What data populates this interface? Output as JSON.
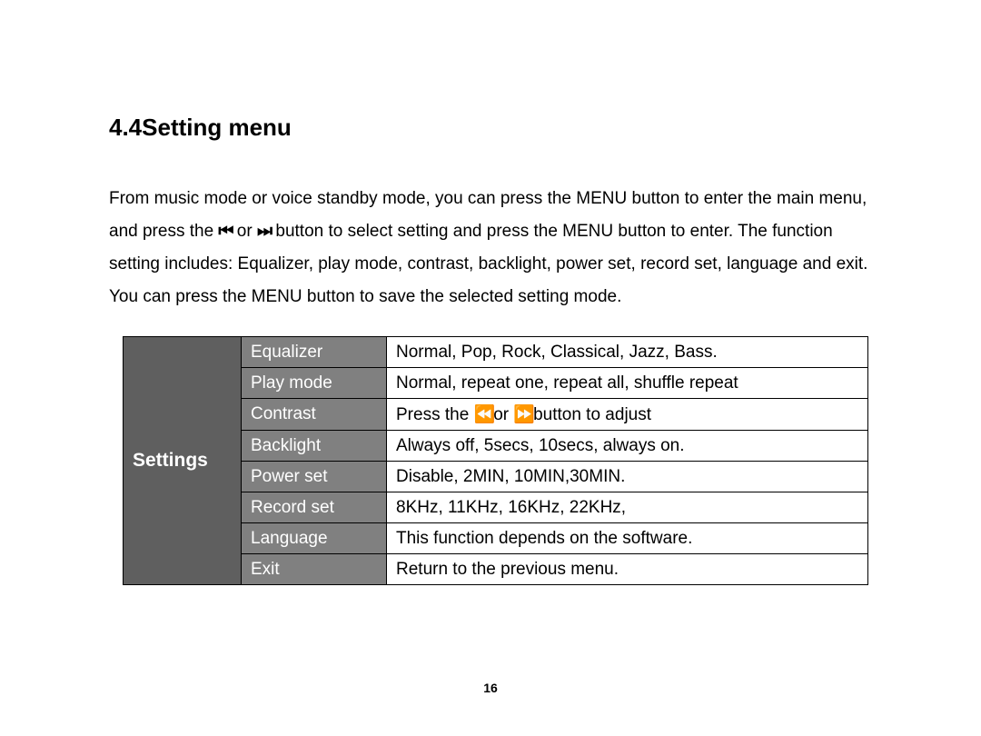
{
  "heading": "4.4Setting menu",
  "para_pre": "From music mode or voice standby mode, you can press the MENU button to enter the main menu, and press the ",
  "para_prev_icon": "⏮",
  "para_mid1": " or ",
  "para_next_icon": "⏭",
  "para_post": " button to select setting and press the MENU button to enter. The function setting includes: Equalizer, play mode, contrast, backlight, power set, record set, language and exit. You can press the MENU button to save the selected setting mode.",
  "table_header": "Settings",
  "rows": [
    {
      "label": "Equalizer",
      "value": "Normal, Pop, Rock, Classical, Jazz, Bass."
    },
    {
      "label": "Play mode",
      "value": "Normal, repeat one, repeat all, shuffle repeat"
    },
    {
      "label": "Contrast",
      "value_pre": "Press the  ",
      "icon1": "⏪",
      "mid": "or  ",
      "icon2": "⏩",
      "value_post": "button to adjust"
    },
    {
      "label": "Backlight",
      "value": "Always off, 5secs, 10secs, always on."
    },
    {
      "label": "Power set",
      "value": "Disable, 2MIN, 10MIN,30MIN."
    },
    {
      "label": "Record set",
      "value": "8KHz, 11KHz, 16KHz, 22KHz,"
    },
    {
      "label": "Language",
      "value": "This function depends on the software."
    },
    {
      "label": "Exit",
      "value": "Return to the previous menu."
    }
  ],
  "page_number": "16"
}
